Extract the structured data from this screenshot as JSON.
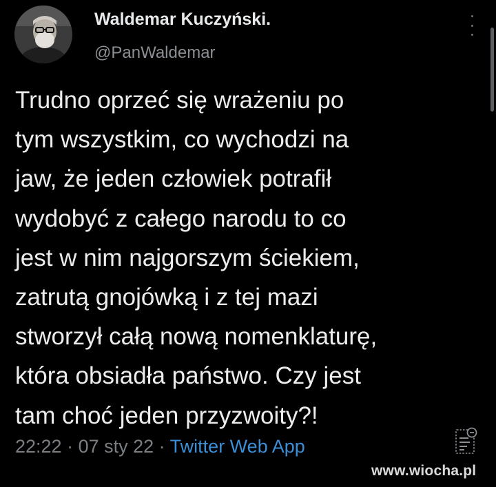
{
  "tweet": {
    "author": {
      "display_name": "Waldemar Kuczyński.",
      "handle": "@PanWaldemar",
      "avatar": "avatar-photo"
    },
    "menu_icon": "more-vertical-icon",
    "text_lines": [
      "Trudno oprzeć się wrażeniu po",
      "tym wszystkim, co wychodzi na",
      "jaw, że jeden człowiek potrafił",
      "wydobyć z całego narodu to co",
      "jest w nim najgorszym ściekiem,",
      "zatrutą gnojówką i z tej mazi",
      "stworzył całą nową nomenklaturę,",
      "która obsiadła państwo. Czy jest",
      "tam choć jeden przyzwoity?!"
    ],
    "time": "22:22",
    "separator": " · ",
    "date": "07 sty 22",
    "source": "Twitter Web App",
    "analytics_icon": "tweet-analytics-icon"
  },
  "watermark": "www.wiocha.pl",
  "colors": {
    "background": "#000000",
    "text": "#ececec",
    "secondary": "#7b7f84",
    "link": "#3a8fd8"
  }
}
